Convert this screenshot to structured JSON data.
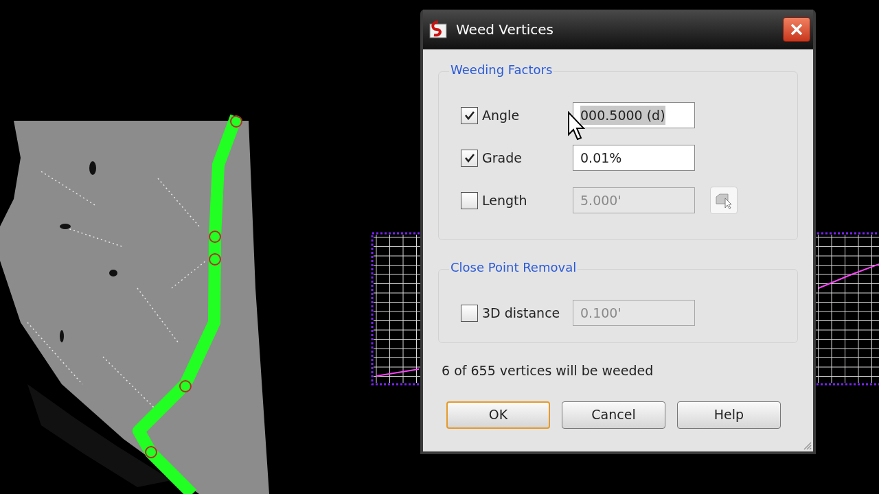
{
  "dialog": {
    "title": "Weed Vertices",
    "groups": [
      {
        "title": "Weeding Factors",
        "rows": [
          {
            "label": "Angle",
            "checked": true,
            "value": "000.5000 (d)",
            "disabled": false,
            "highlighted": true,
            "pick_button": false
          },
          {
            "label": "Grade",
            "checked": true,
            "value": "0.01%",
            "disabled": false,
            "highlighted": false,
            "pick_button": false
          },
          {
            "label": "Length",
            "checked": false,
            "value": "5.000'",
            "disabled": true,
            "highlighted": false,
            "pick_button": true
          }
        ]
      },
      {
        "title": "Close Point Removal",
        "rows": [
          {
            "label": "3D distance",
            "checked": false,
            "value": "0.100'",
            "disabled": true,
            "highlighted": false,
            "pick_button": false
          }
        ]
      }
    ],
    "status": "6 of 655 vertices will be weeded",
    "buttons": [
      {
        "label": "OK",
        "default": true
      },
      {
        "label": "Cancel",
        "default": false
      },
      {
        "label": "Help",
        "default": false
      }
    ]
  }
}
